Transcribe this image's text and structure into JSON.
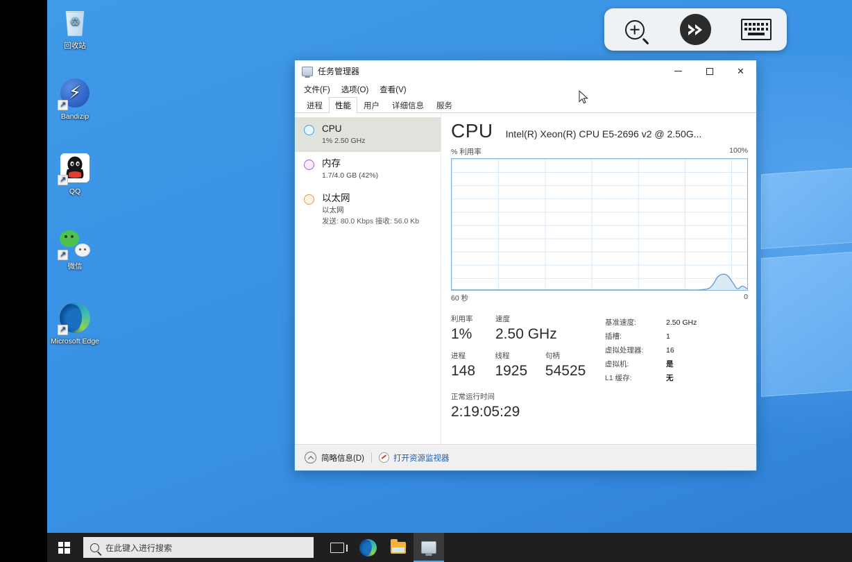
{
  "desktop": {
    "icons": [
      {
        "name": "recycle-bin",
        "label": "回收站"
      },
      {
        "name": "bandizip",
        "label": "Bandizip"
      },
      {
        "name": "qq",
        "label": "QQ"
      },
      {
        "name": "wechat",
        "label": "微信"
      },
      {
        "name": "edge",
        "label": "Microsoft Edge"
      }
    ]
  },
  "rdp_toolbar": {
    "buttons": [
      {
        "name": "zoom-in-icon",
        "title": "Zoom"
      },
      {
        "name": "remote-desktop-logo-icon",
        "title": "Remote Desktop"
      },
      {
        "name": "keyboard-icon",
        "title": "Keyboard"
      }
    ]
  },
  "taskbar": {
    "start_label": "开始",
    "search_placeholder": "在此键入进行搜索",
    "items": [
      {
        "name": "task-view",
        "label": "任务视图"
      },
      {
        "name": "edge",
        "label": "Microsoft Edge"
      },
      {
        "name": "file-explorer",
        "label": "文件资源管理器"
      },
      {
        "name": "task-manager",
        "label": "任务管理器",
        "active": true
      }
    ]
  },
  "window": {
    "title": "任务管理器",
    "controls": {
      "minimize": "最小化",
      "maximize": "最大化",
      "close": "关闭"
    },
    "menus": [
      {
        "label": "文件(F)"
      },
      {
        "label": "选项(O)"
      },
      {
        "label": "查看(V)"
      }
    ],
    "tabs": [
      {
        "label": "进程",
        "active": false
      },
      {
        "label": "性能",
        "active": true
      },
      {
        "label": "用户",
        "active": false
      },
      {
        "label": "详细信息",
        "active": false
      },
      {
        "label": "服务",
        "active": false
      }
    ]
  },
  "sidebar": {
    "items": [
      {
        "name": "cpu",
        "title": "CPU",
        "subtitle": "1% 2.50 GHz",
        "subtitle2": "",
        "color": "#3f9fd8",
        "selected": true
      },
      {
        "name": "memory",
        "title": "内存",
        "subtitle": "1.7/4.0 GB (42%)",
        "subtitle2": "",
        "color": "#a55ed0",
        "selected": false
      },
      {
        "name": "ethernet",
        "title": "以太网",
        "subtitle": "以太网",
        "subtitle2": "发送: 80.0 Kbps 接收: 56.0 Kb",
        "color": "#e39b3f",
        "selected": false
      }
    ]
  },
  "main": {
    "heading": "CPU",
    "model": "Intel(R) Xeon(R) CPU E5-2696 v2 @ 2.50G...",
    "chart_axis_top_left": "% 利用率",
    "chart_axis_top_right": "100%",
    "chart_axis_bottom_left": "60 秒",
    "chart_axis_bottom_right": "0",
    "stats": {
      "utilization_label": "利用率",
      "utilization_value": "1%",
      "speed_label": "速度",
      "speed_value": "2.50 GHz",
      "processes_label": "进程",
      "processes_value": "148",
      "threads_label": "线程",
      "threads_value": "1925",
      "handles_label": "句柄",
      "handles_value": "54525",
      "uptime_label": "正常运行时间",
      "uptime_value": "2:19:05:29"
    },
    "info": [
      {
        "key": "基准速度:",
        "value": "2.50 GHz",
        "strong": false
      },
      {
        "key": "插槽:",
        "value": "1",
        "strong": false
      },
      {
        "key": "虚拟处理器:",
        "value": "16",
        "strong": false
      },
      {
        "key": "虚拟机:",
        "value": "是",
        "strong": true
      },
      {
        "key": "L1 缓存:",
        "value": "无",
        "strong": true
      }
    ]
  },
  "footer": {
    "fewer_details_label": "简略信息(D)",
    "resource_monitor_label": "打开资源监视器"
  },
  "chart_data": {
    "type": "area",
    "title": "% 利用率",
    "xlabel": "60 秒",
    "ylabel": "% 利用率",
    "ylim": [
      0,
      100
    ],
    "xlim": [
      60,
      0
    ],
    "grid": true,
    "grid_columns": 6,
    "grid_rows": 10,
    "line_color": "#6c9fd0",
    "fill_color": "#dce9f6",
    "series": [
      {
        "name": "CPU 利用率",
        "x": [
          60,
          56,
          52,
          48,
          44,
          40,
          36,
          32,
          28,
          24,
          20,
          16,
          12,
          10,
          8,
          7,
          6,
          5,
          4,
          3,
          2,
          1,
          0
        ],
        "values": [
          0,
          0,
          0,
          0,
          0,
          0,
          0,
          0,
          0,
          0,
          0,
          0,
          0,
          0,
          1,
          4,
          10,
          12,
          11,
          6,
          1,
          3,
          1
        ]
      }
    ]
  },
  "colors": {
    "accent": "#3f8fd2",
    "link": "#1a5fb4",
    "desktop_bg": "#3890e4",
    "taskbar_bg": "#1f1f1f"
  }
}
